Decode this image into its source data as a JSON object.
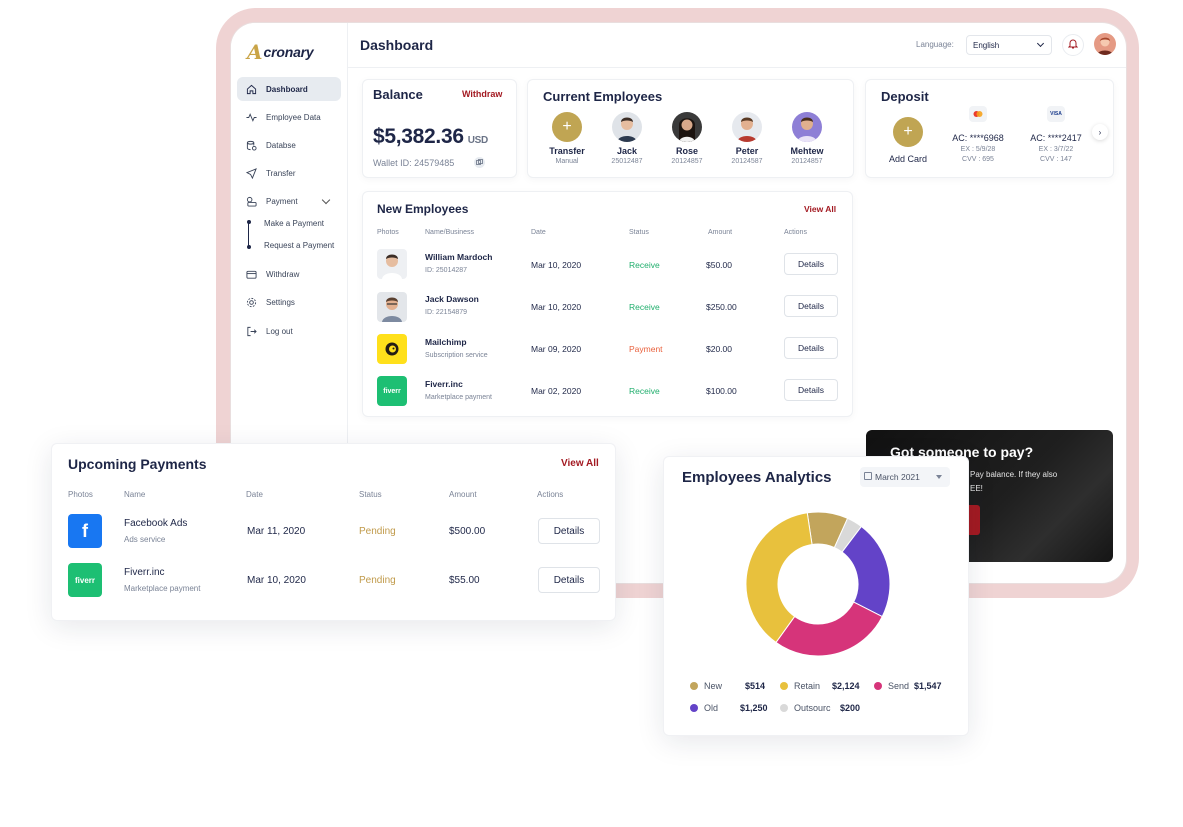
{
  "app": {
    "logo_mark": "A",
    "logo_text": "cronary"
  },
  "sidebar": {
    "items": [
      {
        "label": "Dashboard",
        "icon": "home-icon",
        "active": true
      },
      {
        "label": "Employee Data",
        "icon": "activity-icon"
      },
      {
        "label": "Databse",
        "icon": "database-icon"
      },
      {
        "label": "Transfer",
        "icon": "send-icon"
      },
      {
        "label": "Payment",
        "icon": "payment-icon"
      },
      {
        "label": "Withdraw",
        "icon": "wallet-icon"
      },
      {
        "label": "Settings",
        "icon": "gear-icon"
      },
      {
        "label": "Log out",
        "icon": "logout-icon"
      }
    ],
    "payment_sub": [
      "Make a Payment",
      "Request a Payment"
    ]
  },
  "header": {
    "title": "Dashboard",
    "language_label": "Language:",
    "language_value": "English"
  },
  "balance": {
    "title": "Balance",
    "withdraw": "Withdraw",
    "amount": "$5,382.36",
    "currency": "USD",
    "wallet_id": "Wallet ID: 24579485"
  },
  "current_employees": {
    "title": "Current Employees",
    "people": [
      {
        "name": "Transfer",
        "sub": "Manual"
      },
      {
        "name": "Jack",
        "sub": "25012487"
      },
      {
        "name": "Rose",
        "sub": "20124857"
      },
      {
        "name": "Peter",
        "sub": "20124587"
      },
      {
        "name": "Mehtew",
        "sub": "20124857"
      }
    ]
  },
  "deposit": {
    "title": "Deposit",
    "add_card": "Add Card",
    "cards": [
      {
        "brand": "mastercard-icon",
        "ac": "AC: ****6968",
        "ex": "EX : 5/9/28",
        "cvv": "CVV : 695"
      },
      {
        "brand": "VISA",
        "ac": "AC: ****2417",
        "ex": "EX : 3/7/22",
        "cvv": "CVV : 147"
      }
    ],
    "next": "›"
  },
  "new_employees": {
    "title": "New Employees",
    "view_all": "View All",
    "columns": [
      "Photos",
      "Name/Business",
      "Date",
      "Status",
      "Amount",
      "Actions"
    ],
    "rows": [
      {
        "name": "William Mardoch",
        "sub": "ID: 25014287",
        "date": "Mar 10, 2020",
        "status": "Receive",
        "amount": "$50.00",
        "action": "Details"
      },
      {
        "name": "Jack Dawson",
        "sub": "ID: 22154879",
        "date": "Mar 10, 2020",
        "status": "Receive",
        "amount": "$250.00",
        "action": "Details"
      },
      {
        "name": "Mailchimp",
        "sub": "Subscription service",
        "date": "Mar 09, 2020",
        "status": "Payment",
        "amount": "$20.00",
        "action": "Details"
      },
      {
        "name": "Fiverr.inc",
        "sub": "Marketplace payment",
        "date": "Mar 02, 2020",
        "status": "Receive",
        "amount": "$100.00",
        "action": "Details"
      }
    ],
    "fiverr_logo": "fiverr"
  },
  "promo": {
    "title": "Got someone to pay?",
    "text_line1": "Pay balance. If they also",
    "text_line2": "EE!"
  },
  "upcoming": {
    "title": "Upcoming Payments",
    "view_all": "View All",
    "columns": [
      "Photos",
      "Name",
      "Date",
      "Status",
      "Amount",
      "Actions"
    ],
    "rows": [
      {
        "logo": "f",
        "name": "Facebook Ads",
        "sub": "Ads service",
        "date": "Mar 11, 2020",
        "status": "Pending",
        "amount": "$500.00",
        "action": "Details"
      },
      {
        "logo": "fiverr",
        "name": "Fiverr.inc",
        "sub": "Marketplace payment",
        "date": "Mar 10, 2020",
        "status": "Pending",
        "amount": "$55.00",
        "action": "Details"
      }
    ]
  },
  "analytics": {
    "title": "Employees Analytics",
    "month": "March 2021",
    "legend": [
      {
        "label": "New",
        "value": "$514",
        "color": "#c2a55c"
      },
      {
        "label": "Retain",
        "value": "$2,124",
        "color": "#e8c13d"
      },
      {
        "label": "Send",
        "value": "$1,547",
        "color": "#d6347a"
      },
      {
        "label": "Old",
        "value": "$1,250",
        "color": "#6343c8"
      },
      {
        "label": "Outsourc",
        "value": "$200",
        "color": "#d9d9d9"
      }
    ]
  },
  "colors": {
    "accent": "#a31a22",
    "gold": "#c0a553",
    "navy": "#1e2647",
    "receive": "#1fae6c",
    "payment": "#e9613d",
    "pending": "#c09a4a"
  }
}
